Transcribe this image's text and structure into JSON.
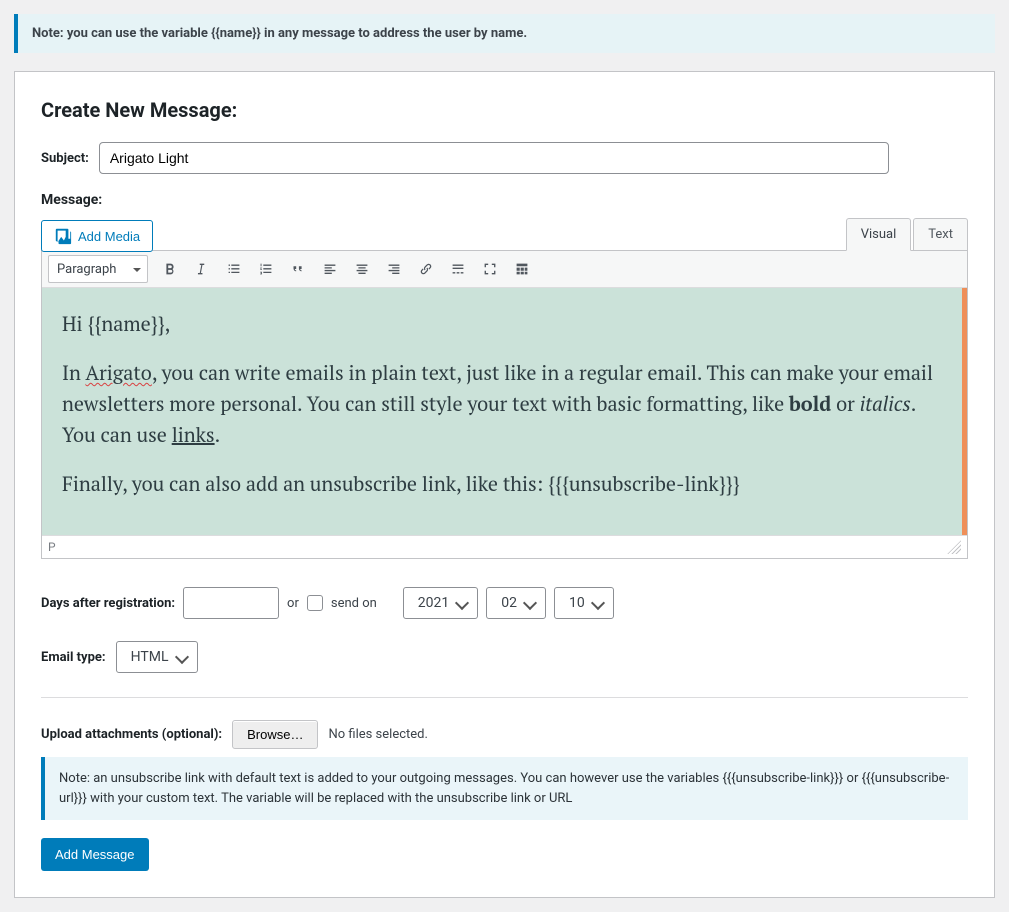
{
  "top_note": "Note: you can use the variable {{name}} in any message to address the user by name.",
  "heading": "Create New Message:",
  "labels": {
    "subject": "Subject:",
    "message": "Message:",
    "days_after_reg": "Days after registration:",
    "or": "or",
    "send_on": "send on",
    "email_type": "Email type:",
    "upload_attach": "Upload attachments (optional):",
    "no_files": "No files selected."
  },
  "subject_value": "Arigato Light",
  "add_media_label": "Add Media",
  "editor": {
    "tabs": {
      "visual": "Visual",
      "text": "Text"
    },
    "format_select": "Paragraph",
    "path": "P",
    "content": {
      "greeting": "Hi {{name}},",
      "p2_prefix": "In ",
      "p2_spell": "Arigato",
      "p2_mid": ", you can write emails in plain text, just like in a regular email. This can make your email newsletters more personal. You can still style your text with basic formatting, like ",
      "p2_bold": "bold",
      "p2_or": " or ",
      "p2_italic": "italics",
      "p2_after_italic": ". You can use ",
      "p2_link": "links",
      "p2_end": ".",
      "p3": "Finally, you can also add an unsubscribe link, like this: {{{unsubscribe-link}}}"
    }
  },
  "schedule": {
    "days_value": "",
    "year": "2021",
    "month": "02",
    "day": "10"
  },
  "email_type_value": "HTML",
  "browse_label": "Browse…",
  "bottom_note": "Note: an unsubscribe link with default text is added to your outgoing messages. You can however use the variables {{{unsubscribe-link}}} or {{{unsubscribe-url}}} with your custom text. The variable will be replaced with the unsubscribe link or URL",
  "submit_label": "Add Message"
}
